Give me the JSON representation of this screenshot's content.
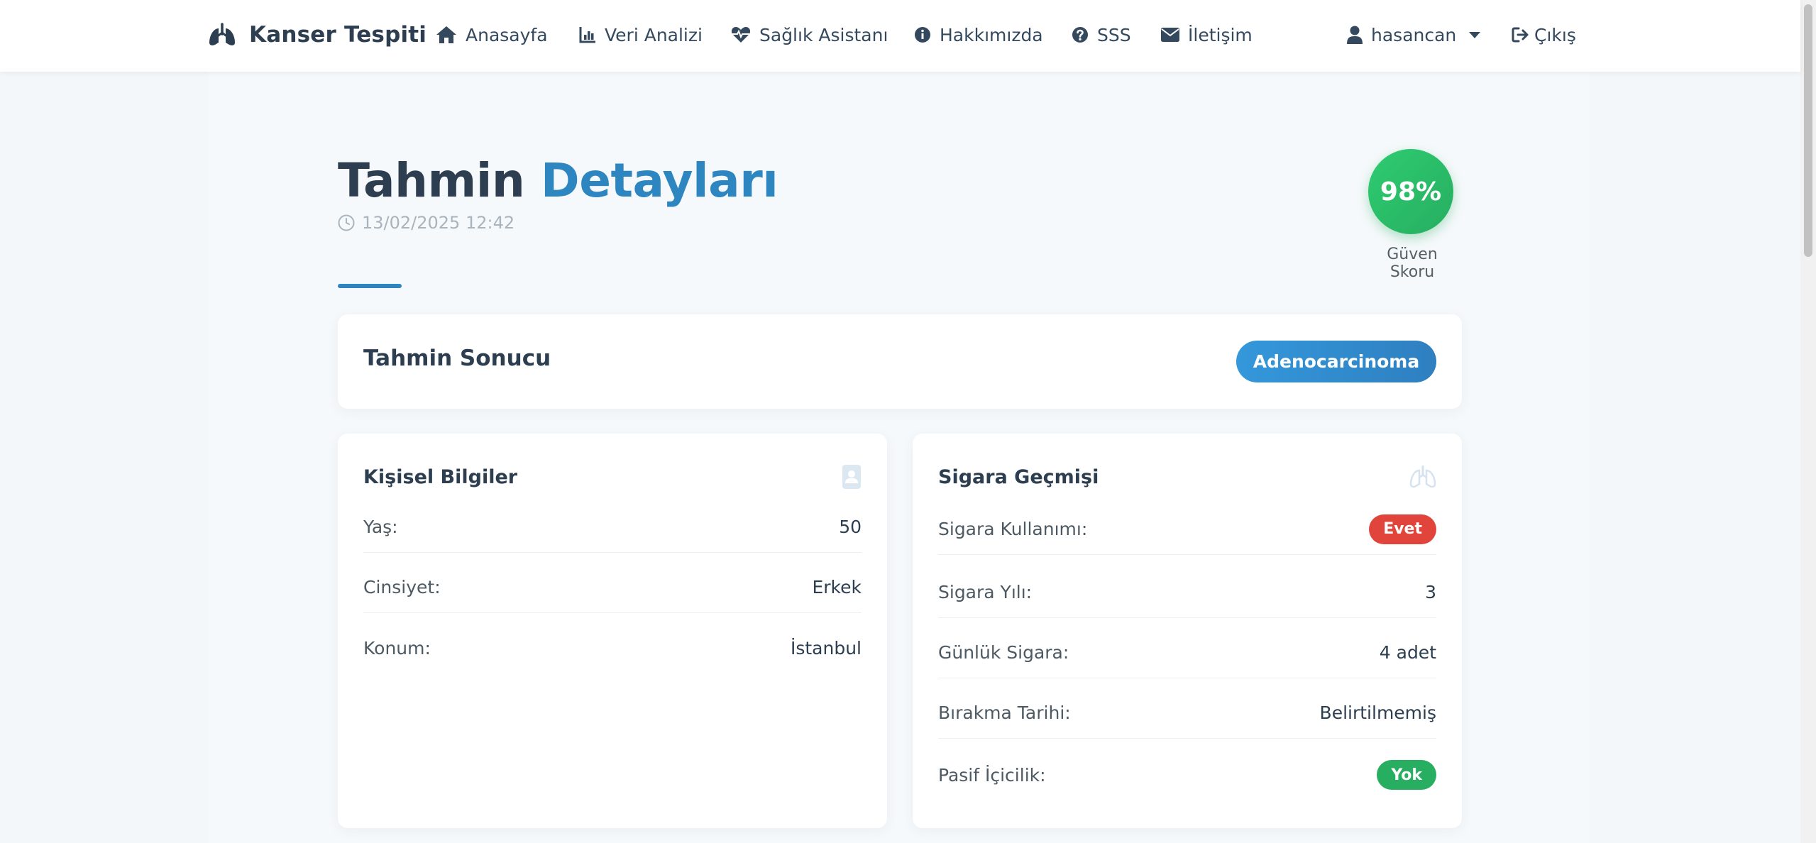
{
  "navbar": {
    "brand": "Kanser Tespiti",
    "items": [
      {
        "label": "Anasayfa",
        "icon": "home-icon"
      },
      {
        "label": "Veri Analizi",
        "icon": "chart-bar-icon"
      },
      {
        "label": "Sağlık Asistanı",
        "icon": "heart-pulse-icon"
      },
      {
        "label": "Hakkımızda",
        "icon": "info-circle-icon"
      },
      {
        "label": "SSS",
        "icon": "question-circle-icon"
      },
      {
        "label": "İletişim",
        "icon": "envelope-icon"
      }
    ],
    "user": {
      "name": "hasancan",
      "icon": "user-icon"
    },
    "logout": {
      "label": "Çıkış",
      "icon": "sign-out-icon"
    }
  },
  "header": {
    "title_part1": "Tahmin",
    "title_part2": "Detayları",
    "timestamp": "13/02/2025 12:42",
    "score": "98%",
    "score_label": "Güven Skoru"
  },
  "result": {
    "title": "Tahmin Sonucu",
    "badge": "Adenocarcinoma"
  },
  "personal": {
    "title": "Kişisel Bilgiler",
    "icon": "id-card-icon",
    "rows": [
      {
        "label": "Yaş:",
        "value": "50"
      },
      {
        "label": "Cinsiyet:",
        "value": "Erkek"
      },
      {
        "label": "Konum:",
        "value": "İstanbul"
      }
    ]
  },
  "smoking": {
    "title": "Sigara Geçmişi",
    "icon": "lungs-icon",
    "rows": [
      {
        "label": "Sigara Kullanımı:",
        "value": "Evet"
      },
      {
        "label": "Sigara Yılı:",
        "value": "3"
      },
      {
        "label": "Günlük Sigara:",
        "value": "4 adet"
      },
      {
        "label": "Bırakma Tarihi:",
        "value": "Belirtilmemiş"
      },
      {
        "label": "Pasif İçicilik:",
        "value": "Yok"
      }
    ]
  },
  "colors": {
    "primary": "#2e86c1",
    "dark": "#2c3e50",
    "success": "#27ae60",
    "danger": "#e0443a"
  }
}
